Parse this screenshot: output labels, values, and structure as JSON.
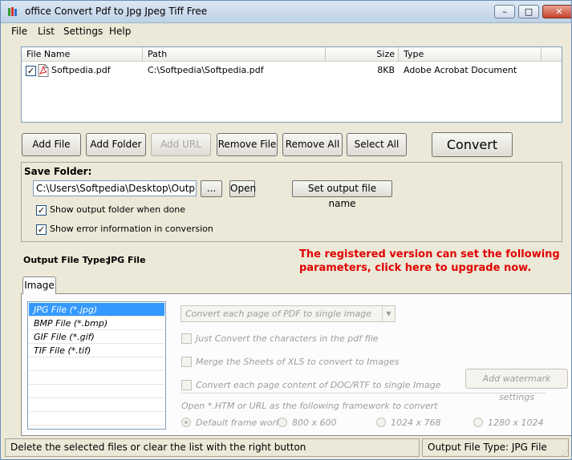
{
  "window": {
    "title": "office Convert Pdf to Jpg Jpeg Tiff Free",
    "minimize": "–",
    "maximize": "□",
    "close": "✕"
  },
  "menu": [
    "File",
    "List",
    "Settings",
    "Help"
  ],
  "filelist": {
    "columns": [
      "File Name",
      "Path",
      "Size",
      "Type"
    ],
    "rows": [
      {
        "name": "Softpedia.pdf",
        "path": "C:\\Softpedia\\Softpedia.pdf",
        "size": "8KB",
        "type": "Adobe Acrobat Document",
        "checked": true
      }
    ]
  },
  "toolbar": {
    "add_file": "Add File",
    "add_folder": "Add Folder",
    "add_url": "Add URL",
    "remove_file": "Remove File",
    "remove_all": "Remove All",
    "select_all": "Select All",
    "convert": "Convert"
  },
  "save": {
    "label": "Save Folder:",
    "path": "C:\\Users\\Softpedia\\Desktop\\Output Files",
    "browse": "...",
    "open": "Open",
    "set_name": "Set output file name",
    "show_folder": "Show output folder when done",
    "show_errors": "Show error information in conversion"
  },
  "output_type": {
    "label": "Output File Type:",
    "value": "JPG File"
  },
  "promo": {
    "line1": "The registered version can set the following",
    "line2": "parameters, click here to upgrade now."
  },
  "tabs": {
    "image": "Image"
  },
  "file_types": [
    "JPG File  (*.jpg)",
    "BMP File  (*.bmp)",
    "GIF File  (*.gif)",
    "TIF File  (*.tif)"
  ],
  "options": {
    "combo": "Convert each page of PDF to single image",
    "just_convert": "Just Convert the characters in the pdf file",
    "merge_sheets": "Merge the Sheets of XLS to convert to Images",
    "convert_doc": "Convert each page content of DOC/RTF to single Image",
    "watermark": "Add watermark settings",
    "framework_label": "Open *.HTM or URL as the following framework to convert",
    "frames": [
      "Default frame work",
      "800 x 600",
      "1024 x 768",
      "1280 x 1024"
    ]
  },
  "status": {
    "left": "Delete the selected files or clear the list with the right button",
    "right": "Output File Type:  JPG File"
  },
  "colors": {
    "promo": "#e00000",
    "selection": "#3399ff"
  }
}
